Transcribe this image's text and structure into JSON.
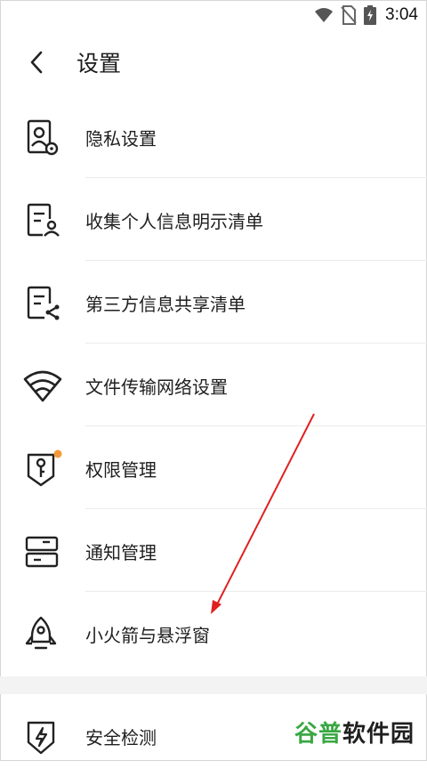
{
  "status": {
    "time": "3:04"
  },
  "header": {
    "title": "设置"
  },
  "rows": [
    {
      "label": "隐私设置",
      "icon": "privacy-settings-icon"
    },
    {
      "label": "收集个人信息明示清单",
      "icon": "personal-info-list-icon"
    },
    {
      "label": "第三方信息共享清单",
      "icon": "third-party-share-icon"
    },
    {
      "label": "文件传输网络设置",
      "icon": "wifi-icon"
    },
    {
      "label": "权限管理",
      "icon": "permission-key-icon"
    },
    {
      "label": "通知管理",
      "icon": "notification-icon"
    },
    {
      "label": "小火箭与悬浮窗",
      "icon": "rocket-icon"
    },
    {
      "label": "安全检测",
      "icon": "security-check-icon"
    }
  ],
  "watermark": {
    "part1": "谷普",
    "part2": "软件园"
  },
  "colors": {
    "badge": "#f29a38",
    "arrow": "#e02020",
    "watermark_green": "#3aa744"
  }
}
